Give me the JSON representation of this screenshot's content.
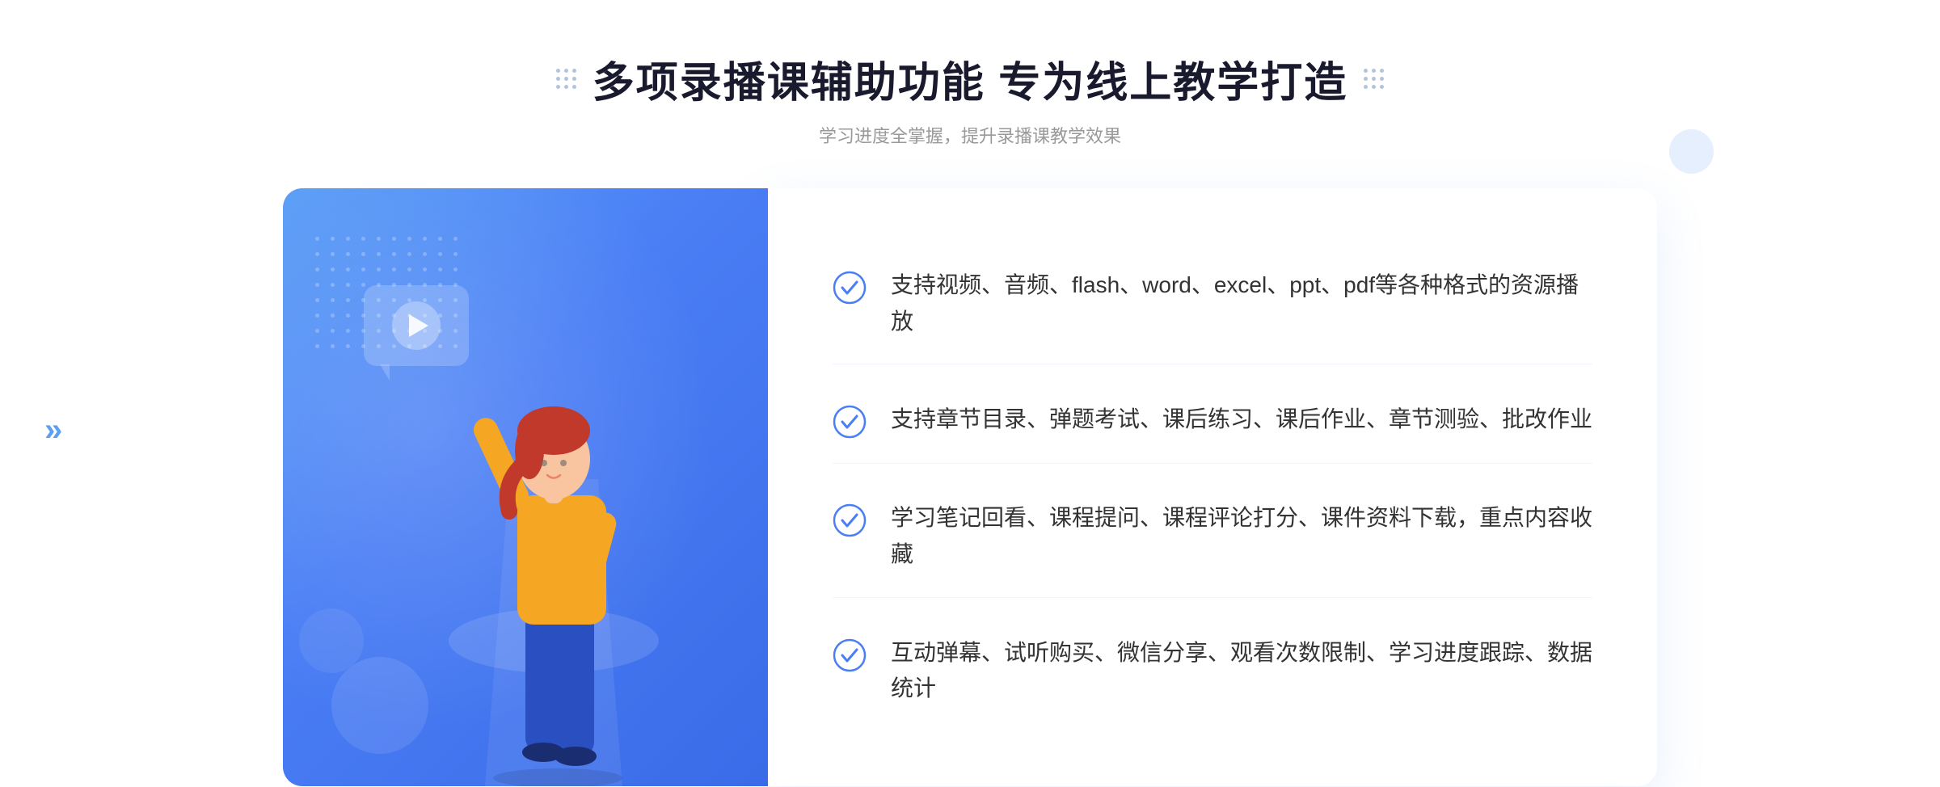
{
  "header": {
    "title": "多项录播课辅助功能 专为线上教学打造",
    "subtitle": "学习进度全掌握，提升录播课教学效果",
    "dots_left_label": "decoration-dots-left",
    "dots_right_label": "decoration-dots-right"
  },
  "features": [
    {
      "id": 1,
      "text": "支持视频、音频、flash、word、excel、ppt、pdf等各种格式的资源播放"
    },
    {
      "id": 2,
      "text": "支持章节目录、弹题考试、课后练习、课后作业、章节测验、批改作业"
    },
    {
      "id": 3,
      "text": "学习笔记回看、课程提问、课程评论打分、课件资料下载，重点内容收藏"
    },
    {
      "id": 4,
      "text": "互动弹幕、试听购买、微信分享、观看次数限制、学习进度跟踪、数据统计"
    }
  ],
  "colors": {
    "primary_blue": "#4a7ef5",
    "dark_blue": "#3060e0",
    "check_color": "#4a7ef5",
    "text_dark": "#333333",
    "text_light": "#999999"
  },
  "icons": {
    "check": "circle-check",
    "play": "play-triangle",
    "chevron": "chevron-right-double"
  }
}
